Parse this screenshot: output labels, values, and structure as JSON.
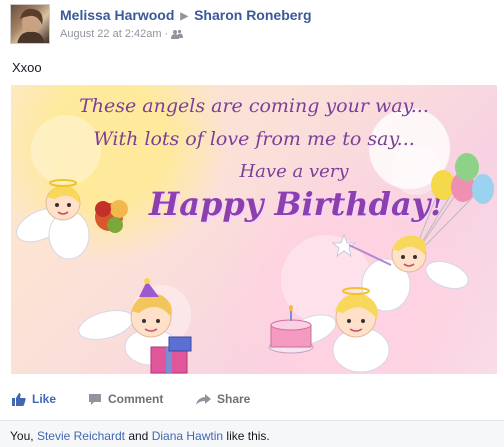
{
  "post": {
    "author": "Melissa Harwood",
    "recipient": "Sharon Roneberg",
    "timestamp": "August 22 at 2:42am",
    "separator": "·",
    "audience_icon": "friends-icon",
    "message": "Xxoo"
  },
  "photo": {
    "lines": [
      "These angels are coming your way...",
      "With lots of love from me to say...",
      "Have a very"
    ],
    "headline": "Happy Birthday!"
  },
  "actions": {
    "like": "Like",
    "comment": "Comment",
    "share": "Share"
  },
  "likes": {
    "prefix": "You,",
    "user1": "Stevie Reichardt",
    "and": "and",
    "user2": "Diana Hawtin",
    "suffix": "like this."
  },
  "colors": {
    "link": "#3b5998",
    "like_blue": "#4267b2",
    "meta_gray": "#90949c",
    "card_text_purple": "#7b3f9a"
  }
}
